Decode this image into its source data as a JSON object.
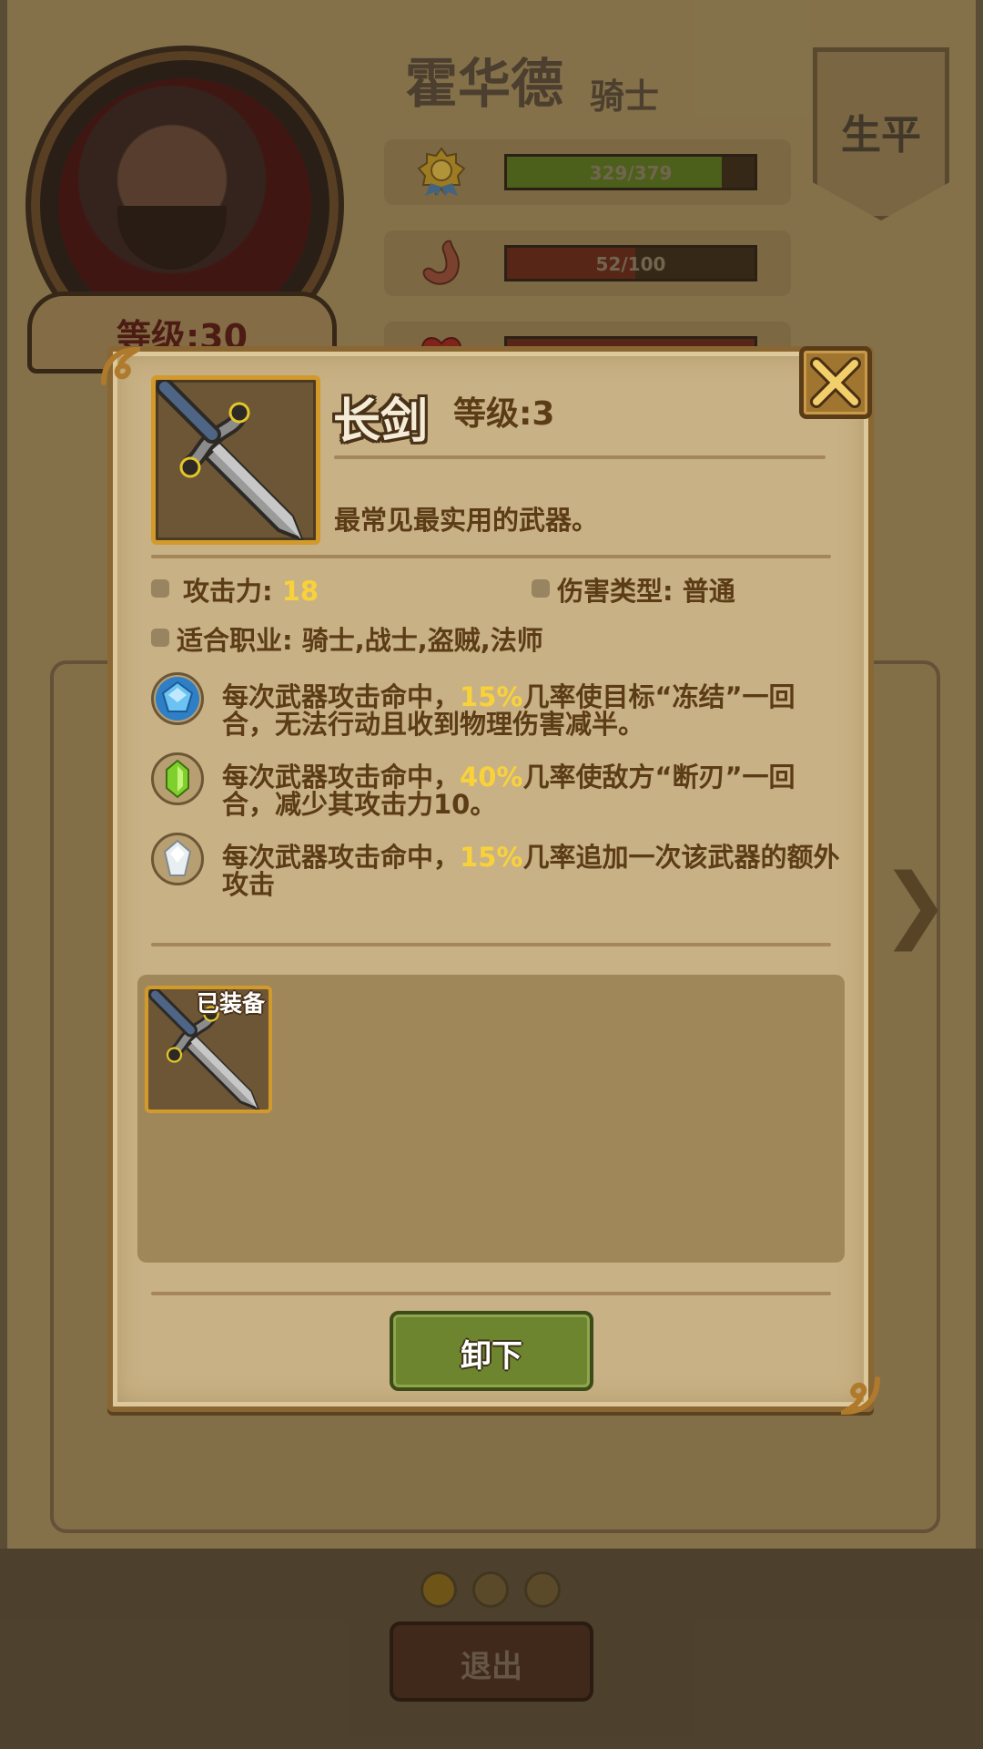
{
  "hero": {
    "name": "霍华德",
    "class": "骑士",
    "level_text": "等级:30",
    "stats": [
      {
        "icon": "medal-icon",
        "text": "329/379",
        "value": 329,
        "max": 379,
        "color": "#5a7a1f"
      },
      {
        "icon": "stomach-icon",
        "text": "52/100",
        "value": 52,
        "max": 100,
        "color": "#6b2a1a"
      },
      {
        "icon": "heart-icon",
        "text": "",
        "value": 100,
        "max": 100,
        "color": "#6b2a1a"
      }
    ]
  },
  "tab": {
    "label": "生平"
  },
  "pagination": {
    "count": 3,
    "active": 0
  },
  "exit_label": "退出",
  "item": {
    "name": "长剑",
    "level": "等级:3",
    "description": "最常见最实用的武器。",
    "attack_label": "攻击力:",
    "attack_value": "18",
    "damage_type": "伤害类型: 普通",
    "classes": "适合职业: 骑士,战士,盗贼,法师",
    "effects": [
      {
        "gem": "blue-gem-icon",
        "prefix": "每次武器攻击命中，",
        "chance": "15%",
        "suffix": "几率使目标“冻结”一回合，无法行动且收到物理伤害减半。"
      },
      {
        "gem": "green-gem-icon",
        "prefix": "每次武器攻击命中，",
        "chance": "40%",
        "suffix": "几率使敌方“断刃”一回合，减少其攻击力10。"
      },
      {
        "gem": "white-gem-icon",
        "prefix": "每次武器攻击命中，",
        "chance": "15%",
        "suffix": "几率追加一次该武器的额外攻击"
      }
    ]
  },
  "inventory": {
    "equipped_tag": "已装备"
  },
  "unequip_label": "卸下",
  "colors": {
    "highlight": "#f9d23a",
    "text": "#5b3c17",
    "frame": "#8a6633"
  }
}
